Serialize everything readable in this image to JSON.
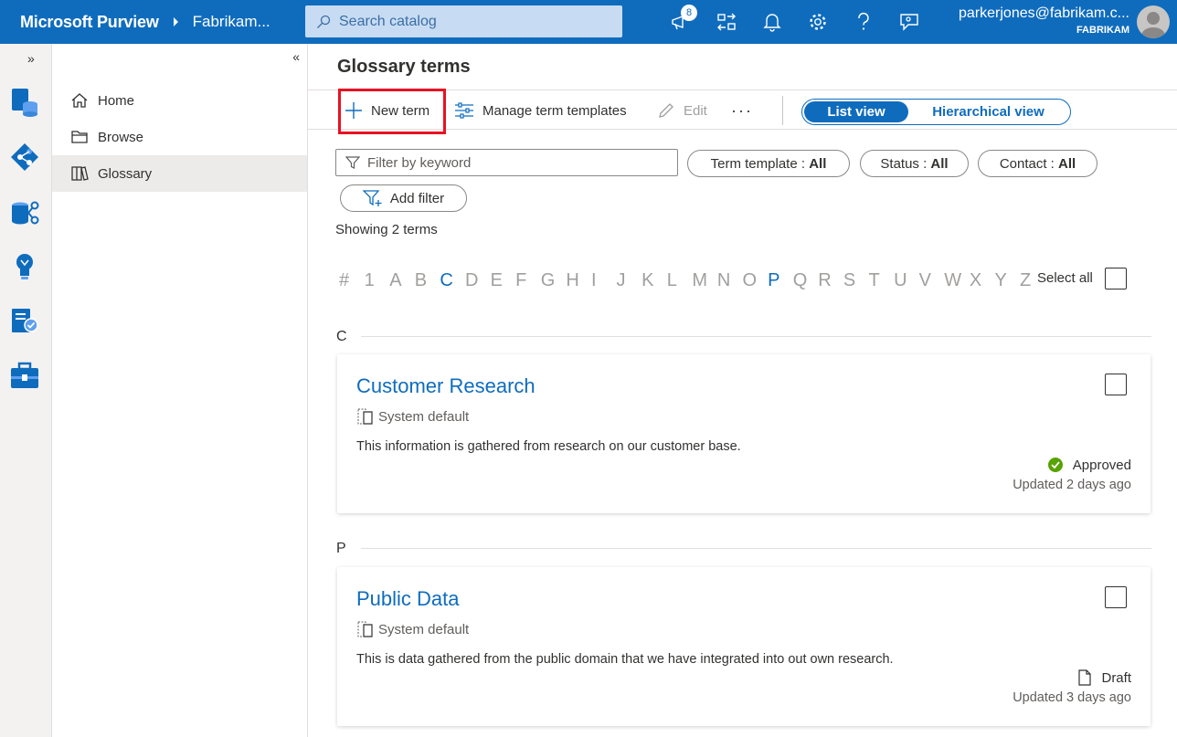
{
  "header": {
    "brand": "Microsoft Purview",
    "tenant": "Fabrikam...",
    "search_placeholder": "Search catalog",
    "notification_count": "8",
    "account_email": "parkerjones@fabrikam.c...",
    "account_org": "FABRIKAM"
  },
  "nav": {
    "items": [
      {
        "label": "Home",
        "icon": "home-icon"
      },
      {
        "label": "Browse",
        "icon": "folder-icon"
      },
      {
        "label": "Glossary",
        "icon": "book-icon"
      }
    ]
  },
  "main": {
    "title": "Glossary terms",
    "commands": {
      "new_term": "New term",
      "manage_templates": "Manage term templates",
      "edit": "Edit",
      "more": "···"
    },
    "view_toggle": {
      "list": "List view",
      "hierarchical": "Hierarchical view"
    },
    "filter_placeholder": "Filter by keyword",
    "filters": [
      {
        "label": "Term template : ",
        "value": "All"
      },
      {
        "label": "Status : ",
        "value": "All"
      },
      {
        "label": "Contact : ",
        "value": "All"
      }
    ],
    "add_filter": "Add filter",
    "showing": "Showing 2 terms",
    "alphabet": [
      "#",
      "1",
      "A",
      "B",
      "C",
      "D",
      "E",
      "F",
      "G",
      "H",
      "I",
      "J",
      "K",
      "L",
      "M",
      "N",
      "O",
      "P",
      "Q",
      "R",
      "S",
      "T",
      "U",
      "V",
      "W",
      "X",
      "Y",
      "Z"
    ],
    "active_letters": [
      "C",
      "P"
    ],
    "select_all": "Select all",
    "sections": [
      {
        "letter": "C",
        "term": {
          "title": "Customer Research",
          "template": "System default",
          "description": "This information is gathered from research on our customer base.",
          "status": "Approved",
          "status_icon": "check-circle-icon",
          "updated": "Updated 2 days ago"
        }
      },
      {
        "letter": "P",
        "term": {
          "title": "Public Data",
          "template": "System default",
          "description": "This is data gathered from the public domain that we have integrated into out own research.",
          "status": "Draft",
          "status_icon": "document-icon",
          "updated": "Updated 3 days ago"
        }
      }
    ]
  },
  "colors": {
    "brand": "#0f6cbd",
    "approved": "#57a300",
    "highlight": "#e81123"
  }
}
